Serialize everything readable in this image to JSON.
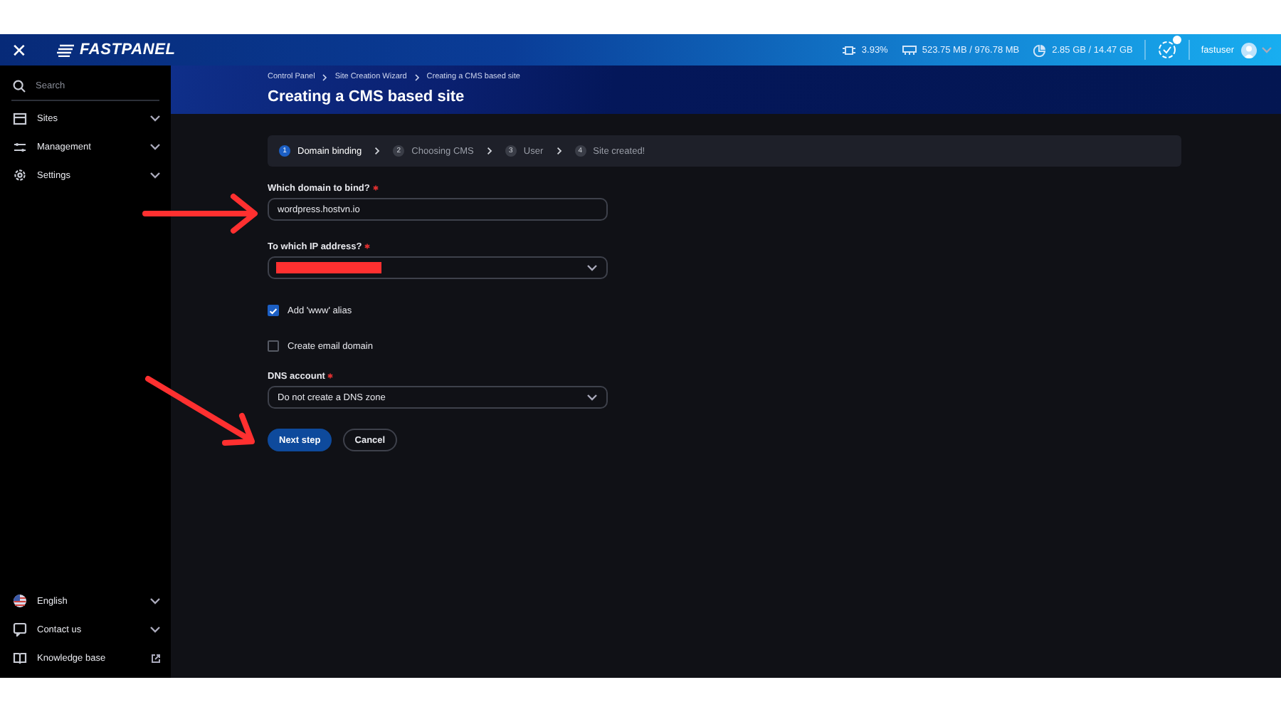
{
  "top_bar": {
    "close": "✕",
    "logo": "FASTPANEL",
    "stats": [
      {
        "kind": "cpu",
        "value": "3.93%"
      },
      {
        "kind": "ram",
        "value": "523.75 MB / 976.78 MB"
      },
      {
        "kind": "disk",
        "value": "2.85 GB / 14.47 GB"
      }
    ],
    "username": "fastuser"
  },
  "sidebar": {
    "search": {
      "placeholder": "Search"
    },
    "items": [
      {
        "kind": "sites",
        "label": "Sites",
        "expanded": false
      },
      {
        "kind": "management",
        "label": "Management",
        "expanded": false
      },
      {
        "kind": "settings",
        "label": "Settings",
        "expanded": false
      }
    ],
    "bottom_items": [
      {
        "kind": "language",
        "label": "English",
        "expanded": false
      },
      {
        "kind": "contact",
        "label": "Contact us",
        "expanded": false
      },
      {
        "kind": "knowledge",
        "label": "Knowledge base",
        "external": true
      }
    ]
  },
  "breadcrumbs": [
    "Control Panel",
    "Site Creation Wizard",
    "Creating a CMS based site"
  ],
  "title": "Creating a CMS based site",
  "steps": [
    {
      "number": "1",
      "label": "Domain binding",
      "selected": true
    },
    {
      "number": "2",
      "label": "Choosing CMS",
      "selected": false
    },
    {
      "number": "3",
      "label": "User",
      "selected": false
    },
    {
      "number": "4",
      "label": "Site created!",
      "selected": false
    }
  ],
  "fields": [
    {
      "kind": "text",
      "label": "Which domain to bind?",
      "required": true,
      "value": "wordpress.hostvn.io"
    },
    {
      "kind": "select",
      "label": "To which IP address?",
      "required": true,
      "redacted": true
    },
    {
      "kind": "checkbox",
      "label": "Add 'www' alias",
      "checked": true
    },
    {
      "kind": "checkbox",
      "label": "Create email domain",
      "checked": false
    },
    {
      "kind": "select",
      "label": "DNS account",
      "required": true,
      "value": "Do not create a DNS zone"
    }
  ],
  "buttons": [
    {
      "kind": "primary",
      "label": "Next step"
    },
    {
      "kind": "secondary",
      "label": "Cancel"
    }
  ]
}
